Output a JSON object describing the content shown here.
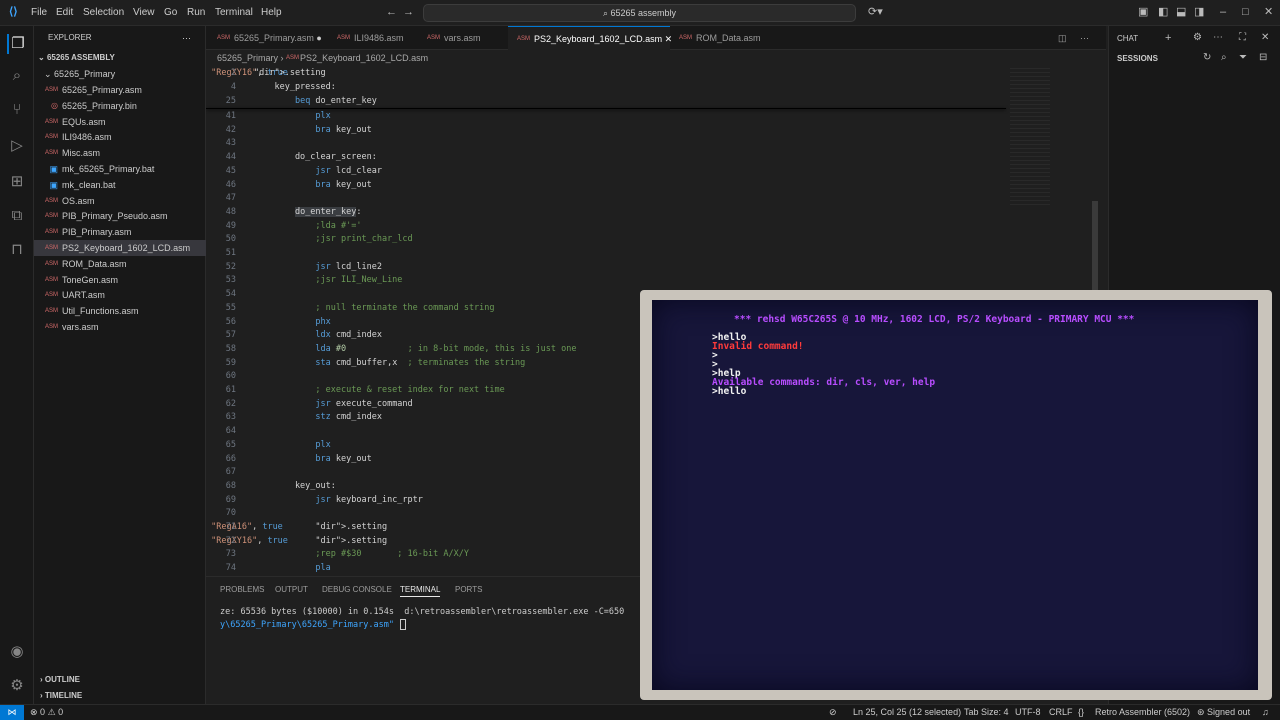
{
  "titlebar": {
    "menu": [
      "File",
      "Edit",
      "Selection",
      "View",
      "Go",
      "Run",
      "Terminal",
      "Help"
    ],
    "search": "65265 assembly",
    "icons": [
      "vscode-logo-icon",
      "back-arrow-icon",
      "forward-arrow-icon",
      "search-icon",
      "copilot-icon",
      "layout-icon",
      "minimize-icon",
      "maximize-icon",
      "close-icon"
    ]
  },
  "activity": [
    "explorer-icon",
    "search-icon",
    "source-control-icon",
    "run-debug-icon",
    "extensions-icon",
    "remote-icon",
    "bookmark-icon",
    "account-icon",
    "settings-icon"
  ],
  "sidebar": {
    "title": "EXPLORER",
    "root": "65265 ASSEMBLY",
    "folder": "65265_Primary",
    "files": [
      "65265_Primary.asm",
      "65265_Primary.bin",
      "EQUs.asm",
      "ILI9486.asm",
      "Misc.asm",
      "mk_65265_Primary.bat",
      "mk_clean.bat",
      "OS.asm",
      "PIB_Primary_Pseudo.asm",
      "PIB_Primary.asm",
      "PS2_Keyboard_1602_LCD.asm",
      "ROM_Data.asm",
      "ToneGen.asm",
      "UART.asm",
      "Util_Functions.asm",
      "vars.asm"
    ],
    "outline": "OUTLINE",
    "timeline": "TIMELINE"
  },
  "tabs": [
    "65265_Primary.asm",
    "ILI9486.asm",
    "vars.asm",
    "PS2_Keyboard_1602_LCD.asm",
    "ROM_Data.asm"
  ],
  "breadcrumb": [
    "65265_Primary",
    "PS2_Keyboard_1602_LCD.asm"
  ],
  "sticky": [
    {
      "n": "2",
      "t": ".setting \"RegXY16\", true"
    },
    {
      "n": "4",
      "t": "    key_pressed:"
    },
    {
      "n": "25",
      "t": "        beq do_enter_key"
    }
  ],
  "code": [
    {
      "n": "41",
      "t": "            plx"
    },
    {
      "n": "42",
      "t": "            bra key_out"
    },
    {
      "n": "43",
      "t": ""
    },
    {
      "n": "44",
      "t": "        do_clear_screen:"
    },
    {
      "n": "45",
      "t": "            jsr lcd_clear"
    },
    {
      "n": "46",
      "t": "            bra key_out"
    },
    {
      "n": "47",
      "t": ""
    },
    {
      "n": "48",
      "t": "        do_enter_key:"
    },
    {
      "n": "49",
      "t": "            ;lda #'='"
    },
    {
      "n": "50",
      "t": "            ;jsr print_char_lcd"
    },
    {
      "n": "51",
      "t": ""
    },
    {
      "n": "52",
      "t": "            jsr lcd_line2"
    },
    {
      "n": "53",
      "t": "            ;jsr ILI_New_Line"
    },
    {
      "n": "54",
      "t": ""
    },
    {
      "n": "55",
      "t": "            ; null terminate the command string"
    },
    {
      "n": "56",
      "t": "            phx"
    },
    {
      "n": "57",
      "t": "            ldx cmd_index"
    },
    {
      "n": "58",
      "t": "            lda #0            ; in 8-bit mode, this is just one"
    },
    {
      "n": "59",
      "t": "            sta cmd_buffer,x  ; terminates the string"
    },
    {
      "n": "60",
      "t": ""
    },
    {
      "n": "61",
      "t": "            ; execute & reset index for next time"
    },
    {
      "n": "62",
      "t": "            jsr execute_command"
    },
    {
      "n": "63",
      "t": "            stz cmd_index"
    },
    {
      "n": "64",
      "t": ""
    },
    {
      "n": "65",
      "t": "            plx"
    },
    {
      "n": "66",
      "t": "            bra key_out"
    },
    {
      "n": "67",
      "t": ""
    },
    {
      "n": "68",
      "t": "        key_out:"
    },
    {
      "n": "69",
      "t": "            jsr keyboard_inc_rptr"
    },
    {
      "n": "70",
      "t": ""
    },
    {
      "n": "71",
      "t": "            .setting \"RegA16\", true"
    },
    {
      "n": "72",
      "t": "            .setting \"RegXY16\", true"
    },
    {
      "n": "73",
      "t": "            ;rep #$30       ; 16-bit A/X/Y"
    },
    {
      "n": "74",
      "t": "            pla"
    }
  ],
  "chat": {
    "title": "CHAT",
    "sessions": "SESSIONS"
  },
  "panel": {
    "tabs": [
      "PROBLEMS",
      "OUTPUT",
      "DEBUG CONSOLE",
      "TERMINAL",
      "PORTS"
    ],
    "term1": "ze: 65536 bytes ($10000) in 0.154s  d:\\retroassembler\\retroassembler.exe -C=650",
    "term2": "y\\65265_Primary\\65265_Primary.asm\""
  },
  "lcd": {
    "banner": "*** rehsd W65C265S @ 10 MHz, 1602 LCD, PS/2 Keyboard - PRIMARY MCU ***",
    "lines": [
      ">hello",
      "Invalid command!",
      ">",
      ">",
      ">help",
      "Available commands: dir, cls, ver, help",
      ">hello"
    ],
    "colors": {
      "banner": "#b84dff",
      "prompt": "#f2f2f2",
      "error": "#ff3b3b",
      "info": "#b84dff"
    }
  },
  "status": {
    "errors": "0",
    "warnings": "0",
    "position": "Ln 25, Col 25 (12 selected)",
    "tabsize": "Tab Size: 4",
    "encoding": "UTF-8",
    "eol": "CRLF",
    "language": "Retro Assembler (6502)",
    "account": "Signed out"
  }
}
